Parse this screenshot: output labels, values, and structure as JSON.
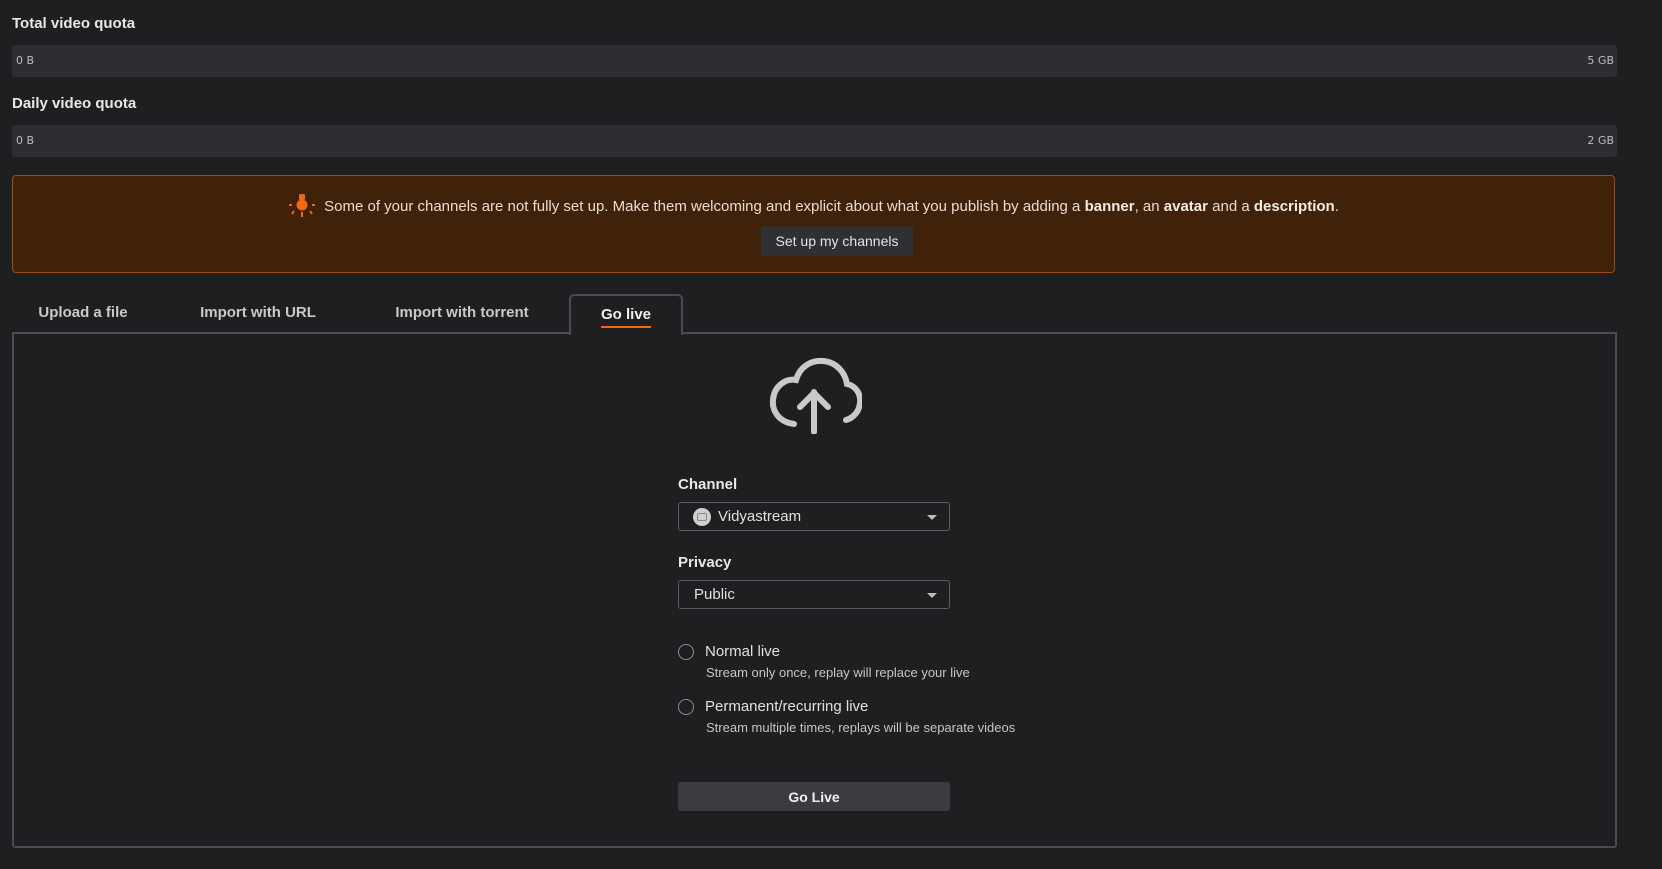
{
  "quotas": {
    "total": {
      "title": "Total video quota",
      "min": "0 B",
      "max": "5 GB",
      "used_fraction": 0
    },
    "daily": {
      "title": "Daily video quota",
      "min": "0 B",
      "max": "2 GB",
      "used_fraction": 0
    }
  },
  "alert": {
    "text_1": "Some of your channels are not fully set up. Make them welcoming and explicit about what you publish by adding a ",
    "bold_banner": "banner",
    "text_2": ", an ",
    "bold_avatar": "avatar",
    "text_3": " and a ",
    "bold_description": "description",
    "text_4": ".",
    "button_label": "Set up my channels",
    "icon": "lightbulb-icon",
    "accent_color": "#f2690d"
  },
  "tabs": [
    {
      "label": "Upload a file",
      "active": false
    },
    {
      "label": "Import with URL",
      "active": false
    },
    {
      "label": "Import with torrent",
      "active": false
    },
    {
      "label": "Go live",
      "active": true
    }
  ],
  "form": {
    "channel_label": "Channel",
    "channel_value": "Vidyastream",
    "privacy_label": "Privacy",
    "privacy_value": "Public",
    "options": [
      {
        "label": "Normal live",
        "description": "Stream only once, replay will replace your live",
        "checked": false
      },
      {
        "label": "Permanent/recurring live",
        "description": "Stream multiple times, replays will be separate videos",
        "checked": false
      }
    ],
    "submit_label": "Go Live"
  }
}
